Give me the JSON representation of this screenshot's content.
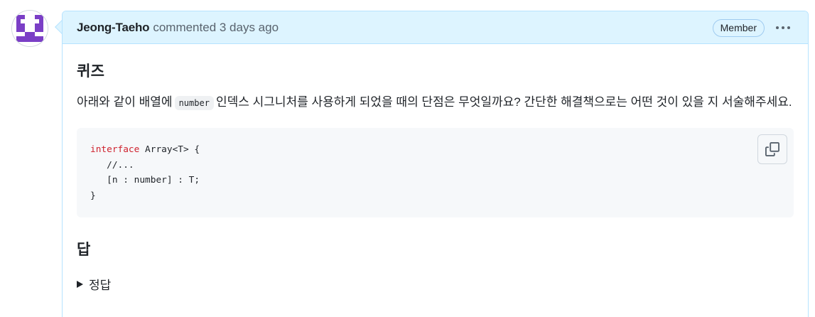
{
  "comment": {
    "author": "Jeong-Taeho",
    "meta": "commented 3 days ago",
    "badge": "Member",
    "more_icon": "kebab-horizontal-icon"
  },
  "body": {
    "quiz_heading": "퀴즈",
    "question_before": "아래와 같이 배열에",
    "question_code": "number",
    "question_after": "인덱스 시그니처를 사용하게 되었을 때의 단점은 무엇일까요? 간단한 해결책으로는 어떤 것이 있을 지 서술해주세요.",
    "code_lines": [
      {
        "kw": "interface",
        "rest": " Array<T> {"
      },
      {
        "kw": "",
        "rest": "   //..."
      },
      {
        "kw": "",
        "rest": "   [n : number] : T;"
      },
      {
        "kw": "",
        "rest": "}"
      }
    ],
    "copy_icon": "copy-icon",
    "answer_heading": "답",
    "details_summary": "정답"
  },
  "colors": {
    "header_bg": "#ddf4ff",
    "header_border": "#b6e3ff",
    "keyword": "#cf222e",
    "code_bg": "#f6f8fa"
  }
}
